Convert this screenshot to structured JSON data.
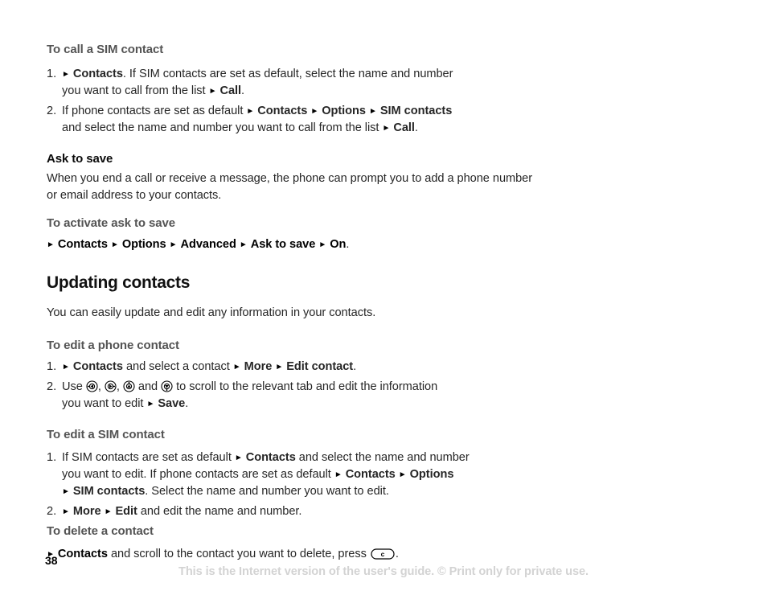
{
  "document": {
    "page_number": "38",
    "footer_note": "This is the Internet version of the user's guide. © Print only for private use."
  },
  "sections": {
    "call_sim": {
      "heading": "To call a SIM contact",
      "steps": [
        {
          "num": "1.",
          "text_line1_pre": "",
          "bold1": "Contacts",
          "text1": ". If SIM contacts are set as default, select the name and number",
          "text2": "you want to call from the list",
          "bold2": "Call",
          "text3": "."
        },
        {
          "num": "2.",
          "text1": "If phone contacts are set as default",
          "bold1": "Contacts",
          "bold2": "Options",
          "bold3": "SIM contacts",
          "text2": "and select the name and number you want to call from the list",
          "bold4": "Call",
          "text3": "."
        }
      ]
    },
    "ask_to_save": {
      "heading": "Ask to save",
      "body": "When you end a call or receive a message, the phone can prompt you to add a phone number or email address to your contacts.",
      "proc_heading": "To activate ask to save",
      "command": {
        "bold1": "Contacts",
        "bold2": "Options",
        "bold3": "Advanced",
        "bold4": "Ask to save",
        "bold5": "On",
        "period": "."
      }
    },
    "updating_contacts": {
      "heading": "Updating contacts",
      "body": "You can easily update and edit any information in your contacts.",
      "edit_phone": {
        "proc_heading": "To edit a phone contact",
        "steps": [
          {
            "num": "1.",
            "bold1": "Contacts",
            "text1": "and select a contact",
            "bold2": "More",
            "bold3": "Edit contact",
            "text2": "."
          },
          {
            "num": "2.",
            "text1": "Use",
            "icon1": "nav-left-key-icon",
            "sep1": ",",
            "icon2": "nav-right-key-icon",
            "sep2": ",",
            "icon3": "nav-up-key-icon",
            "text2": "and",
            "icon4": "nav-down-key-icon",
            "text3": "to scroll to the relevant tab and edit the information",
            "text4": "you want to edit",
            "bold1": "Save",
            "text5": "."
          }
        ]
      },
      "edit_sim": {
        "proc_heading": "To edit a SIM contact",
        "steps": [
          {
            "num": "1.",
            "text1": "If SIM contacts are set as default",
            "bold1": "Contacts",
            "text2": "and select the name and number",
            "text3": "you want to edit. If phone contacts are set as default",
            "bold2": "Contacts",
            "bold3": "Options",
            "bold4": "SIM contacts",
            "text4": ". Select the name and number you want to edit."
          },
          {
            "num": "2.",
            "bold1": "More",
            "bold2": "Edit",
            "text1": "and edit the name and number."
          }
        ]
      },
      "delete": {
        "proc_heading": "To delete a contact",
        "command": {
          "bold1": "Contacts",
          "text1": "and scroll to the contact you want to delete, press",
          "key_label": "c",
          "key_icon": "clear-key-icon",
          "text2": "."
        }
      }
    }
  },
  "glyphs": {
    "triangle_bullet": "►"
  },
  "colors": {
    "body_text": "#262626",
    "bold_text": "#000000",
    "proc_heading": "#545454",
    "section_heading": "#111111",
    "footer_note": "#d3d3d3"
  }
}
